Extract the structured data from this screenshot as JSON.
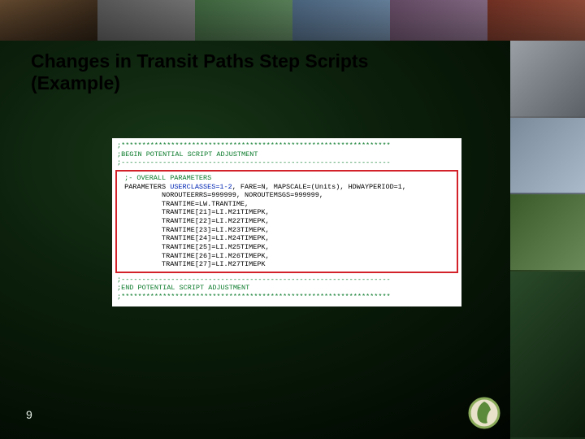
{
  "title_line1": "Changes in Transit Paths Step Scripts",
  "title_line2": "(Example)",
  "page_number": "9",
  "code": {
    "begin_sep": ";*****************************************************************",
    "begin_txt": ";BEGIN POTENTIAL SCRIPT ADJUSTMENT",
    "mid_sep": ";-----------------------------------------------------------------",
    "hl_cmt": " ;- OVERALL PARAMETERS",
    "hl_l1a": " PARAMETERS ",
    "hl_l1b_kw": "USERCLASSES=1-2",
    "hl_l1c": ", FARE=N, MAPSCALE=(Units), HDWAYPERIOD=1,",
    "hl_l2": "          NOROUTEERRS=999999, NOROUTEMSGS=999999,",
    "hl_l3": "          TRANTIME=LW.TRANTIME,",
    "hl_l4": "          TRANTIME[21]=LI.M21TIMEPK,",
    "hl_l5": "          TRANTIME[22]=LI.M22TIMEPK,",
    "hl_l6": "          TRANTIME[23]=LI.M23TIMEPK,",
    "hl_l7": "          TRANTIME[24]=LI.M24TIMEPK,",
    "hl_l8": "          TRANTIME[25]=LI.M25TIMEPK,",
    "hl_l9": "          TRANTIME[26]=LI.M26TIMEPK,",
    "hl_l10": "          TRANTIME[27]=LI.M27TIMEPK",
    "end_txt": ";END POTENTIAL SCRIPT ADJUSTMENT",
    "end_sep": ";*****************************************************************"
  }
}
